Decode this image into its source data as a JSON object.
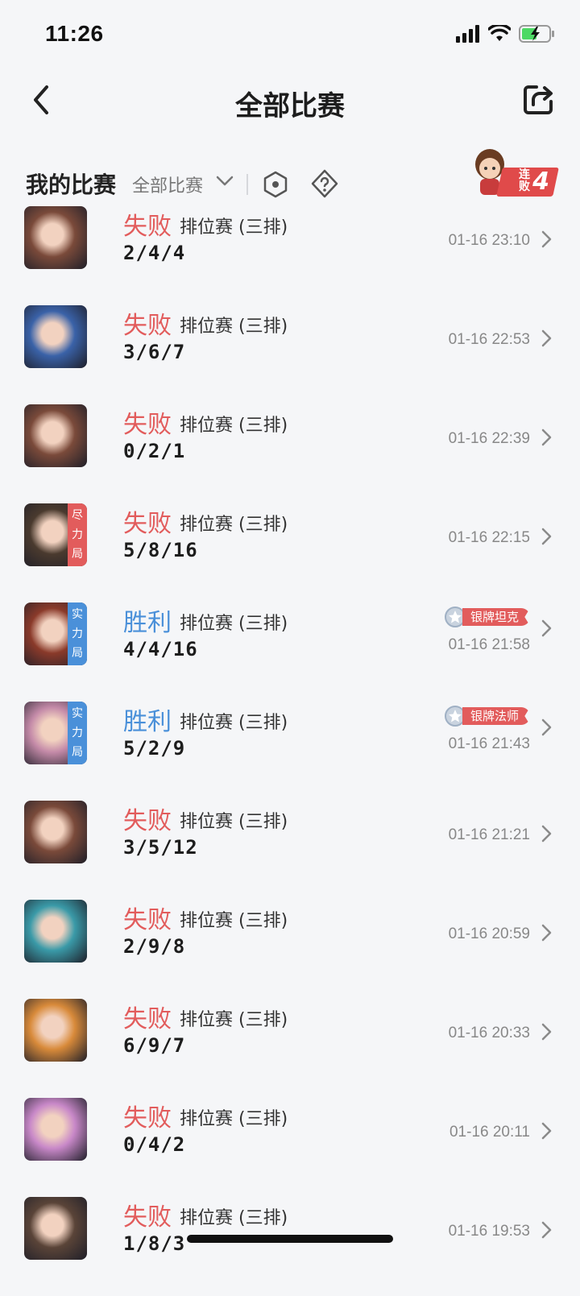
{
  "status_bar": {
    "time": "11:26"
  },
  "nav": {
    "title": "全部比赛"
  },
  "filter": {
    "my_matches": "我的比赛",
    "all_matches": "全部比赛"
  },
  "streak": {
    "label": "连败",
    "count": "4"
  },
  "matches": [
    {
      "result": "失败",
      "type": "loss",
      "mode": "排位赛 (三排)",
      "kda": "2/4/4",
      "time": "01-16 23:10",
      "tag": null,
      "medal": null,
      "hero_color": "#7a4a3a"
    },
    {
      "result": "失败",
      "type": "loss",
      "mode": "排位赛 (三排)",
      "kda": "3/6/7",
      "time": "01-16 22:53",
      "tag": null,
      "medal": null,
      "hero_color": "#3a62a8"
    },
    {
      "result": "失败",
      "type": "loss",
      "mode": "排位赛 (三排)",
      "kda": "0/2/1",
      "time": "01-16 22:39",
      "tag": null,
      "medal": null,
      "hero_color": "#7a4a3a"
    },
    {
      "result": "失败",
      "type": "loss",
      "mode": "排位赛 (三排)",
      "kda": "5/8/16",
      "time": "01-16 22:15",
      "tag": "尽力局",
      "tag_color": "#e25c5c",
      "medal": null,
      "hero_color": "#4a3a2e"
    },
    {
      "result": "胜利",
      "type": "win",
      "mode": "排位赛 (三排)",
      "kda": "4/4/16",
      "time": "01-16 21:58",
      "tag": "实力局",
      "tag_color": "#4a90d9",
      "medal": "银牌坦克",
      "hero_color": "#8a3a2a"
    },
    {
      "result": "胜利",
      "type": "win",
      "mode": "排位赛 (三排)",
      "kda": "5/2/9",
      "time": "01-16 21:43",
      "tag": "实力局",
      "tag_color": "#4a90d9",
      "medal": "银牌法师",
      "hero_color": "#c48aa8"
    },
    {
      "result": "失败",
      "type": "loss",
      "mode": "排位赛 (三排)",
      "kda": "3/5/12",
      "time": "01-16 21:21",
      "tag": null,
      "medal": null,
      "hero_color": "#7a4a3a"
    },
    {
      "result": "失败",
      "type": "loss",
      "mode": "排位赛 (三排)",
      "kda": "2/9/8",
      "time": "01-16 20:59",
      "tag": null,
      "medal": null,
      "hero_color": "#3a9aa8"
    },
    {
      "result": "失败",
      "type": "loss",
      "mode": "排位赛 (三排)",
      "kda": "6/9/7",
      "time": "01-16 20:33",
      "tag": null,
      "medal": null,
      "hero_color": "#d88a3a"
    },
    {
      "result": "失败",
      "type": "loss",
      "mode": "排位赛 (三排)",
      "kda": "0/4/2",
      "time": "01-16 20:11",
      "tag": null,
      "medal": null,
      "hero_color": "#c888c8"
    },
    {
      "result": "失败",
      "type": "loss",
      "mode": "排位赛 (三排)",
      "kda": "1/8/3",
      "time": "01-16 19:53",
      "tag": null,
      "medal": null,
      "hero_color": "#5a4438"
    }
  ]
}
